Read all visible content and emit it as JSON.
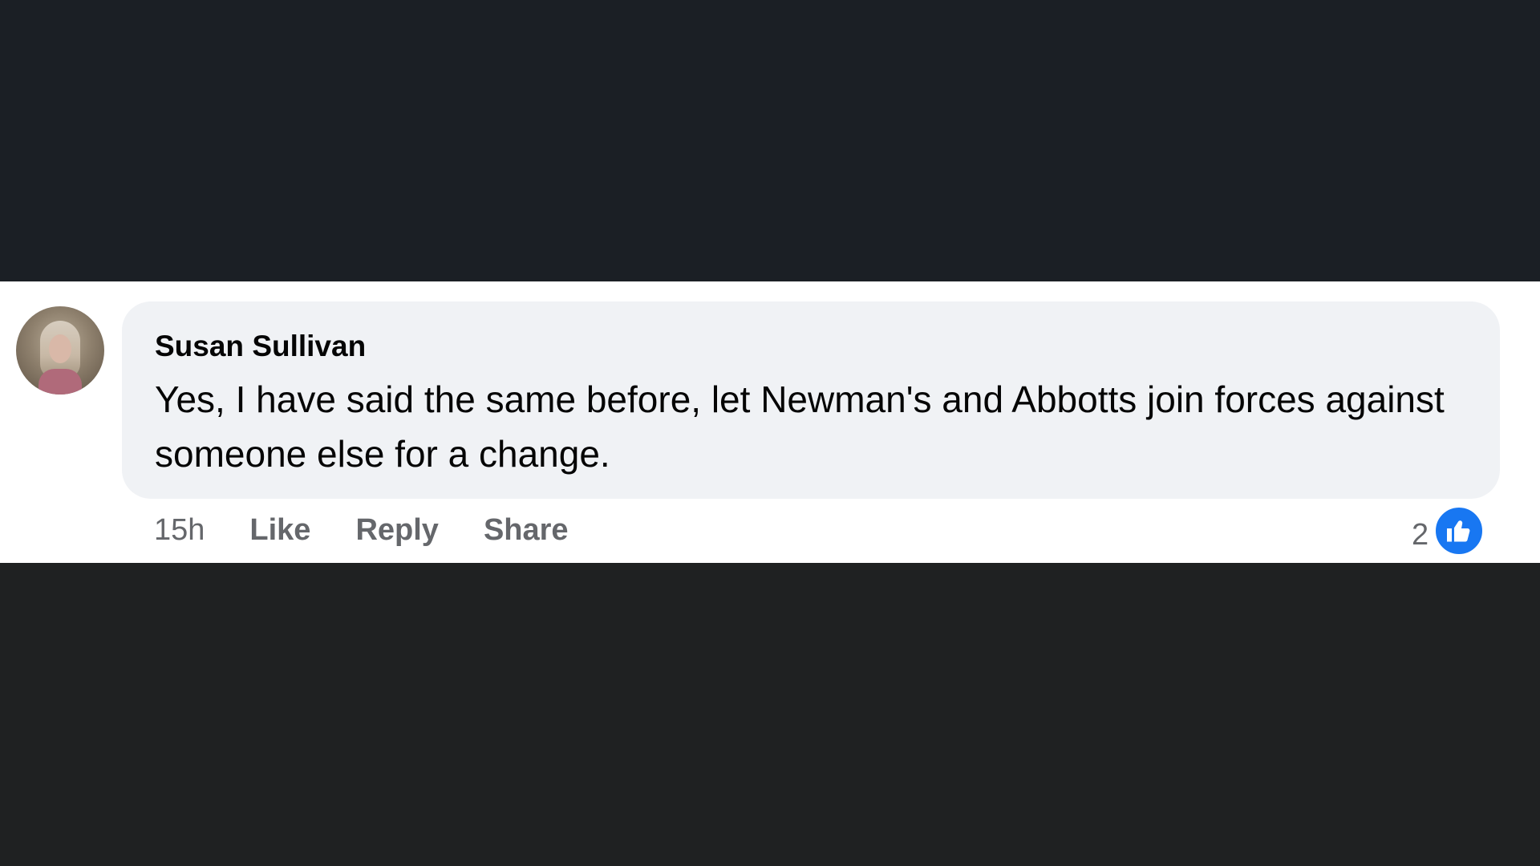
{
  "comment": {
    "author": "Susan Sullivan",
    "text": "Yes, I have said the same before, let Newman's and Abbotts join forces against someone else for a change.",
    "time": "15h",
    "actions": {
      "like": "Like",
      "reply": "Reply",
      "share": "Share"
    },
    "reactions": {
      "count": "2",
      "icon": "thumbs-up-icon"
    }
  },
  "colors": {
    "bubble": "#f0f2f5",
    "accent": "#1877f2",
    "muted_text": "#65676b",
    "text": "#050505",
    "backdrop": "#1b1f25"
  }
}
